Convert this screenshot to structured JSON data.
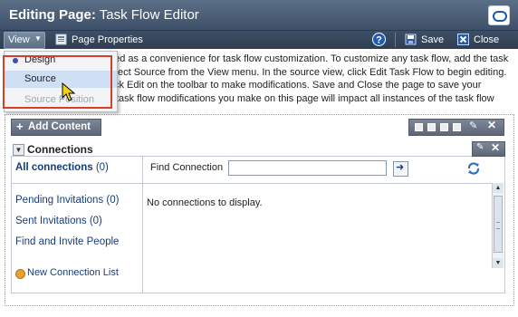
{
  "window": {
    "title_prefix": "Editing Page:",
    "title_name": "Task Flow Editor",
    "logo_icon": "oracle-logo-icon"
  },
  "toolbar": {
    "view_label": "View",
    "page_properties_label": "Page Properties",
    "save_label": "Save",
    "close_label": "Close"
  },
  "description": {
    "lines": [
      "ded as a convenience for task flow customization. To customize any task flow, add the task",
      "ect Source from the View menu. In the source view, click Edit Task Flow to begin editing.",
      "ck Edit on the toolbar to make modifications. Save and Close the page to save your",
      "  task flow modifications you make on this page will impact all instances of the task flow"
    ]
  },
  "view_menu": {
    "items": [
      {
        "label": "Design",
        "state": "radio-selected"
      },
      {
        "label": "Source",
        "state": "highlighted"
      },
      {
        "label": "Source Position",
        "state": "disabled"
      }
    ]
  },
  "add_content": {
    "label": "Add Content"
  },
  "connections": {
    "title": "Connections",
    "all_label": "All connections",
    "all_count": "(0)",
    "pending_label": "Pending Invitations (0)",
    "sent_label": "Sent Invitations (0)",
    "find_invite_label": "Find and Invite People",
    "new_list_label": "New Connection List",
    "find_label": "Find Connection",
    "find_value": "",
    "empty_message": "No connections to display."
  },
  "colors": {
    "title_bar": "#4a5d75",
    "menu_highlight": "#cfe0f4",
    "callout_frame": "#d6402a",
    "link": "#163d7a"
  }
}
